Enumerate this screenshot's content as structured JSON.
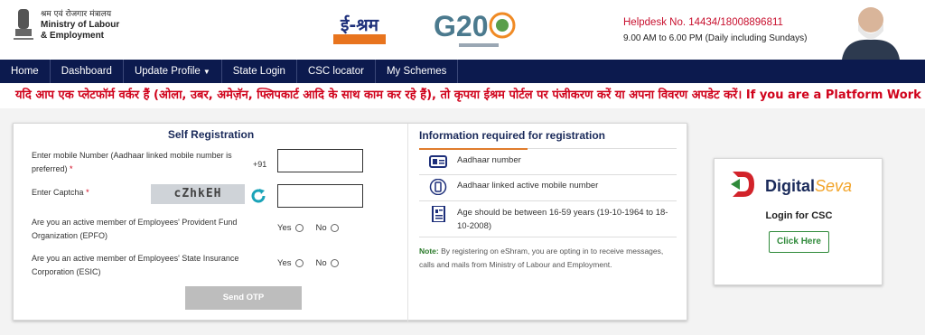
{
  "header": {
    "ministry_hindi": "श्रम एवं रोजगार मंत्रालय",
    "ministry_line1": "Ministry of Labour",
    "ministry_line2": "& Employment",
    "eshram_logo_text": "ई-श्रम",
    "g20_text": "G20",
    "helpdesk": "Helpdesk No. 14434/18008896811",
    "hours": "9.00 AM to 6.00 PM (Daily including Sundays)"
  },
  "nav": {
    "items": [
      "Home",
      "Dashboard",
      "Update Profile",
      "State Login",
      "CSC locator",
      "My Schemes"
    ]
  },
  "ticker": "यदि आप एक प्लेटफॉर्म वर्कर हैं (ओला, उबर, अमेज़ॅन, फ्लिपकार्ट आदि के साथ काम कर रहे हैं), तो कृपया ईश्रम पोर्टल पर पंजीकरण करें या अपना विवरण अपडेट करें। If you are a Platform Work",
  "self_registration": {
    "title": "Self Registration",
    "mobile_label": "Enter mobile Number (Aadhaar linked mobile number is preferred)",
    "country_code": "+91",
    "captcha_label": "Enter Captcha",
    "captcha_text": "cZhkEH",
    "epfo_label": "Are you an active member of Employees' Provident Fund Organization (EPFO)",
    "esic_label": "Are you an active member of Employees' State Insurance Corporation (ESIC)",
    "yes": "Yes",
    "no": "No",
    "send_otp": "Send OTP"
  },
  "info": {
    "title": "Information required for registration",
    "items": [
      "Aadhaar number",
      "Aadhaar linked active mobile number",
      "Age should be between 16-59 years (19-10-1964 to 18-10-2008)"
    ],
    "note_label": "Note:",
    "note_text": " By registering on eShram, you are opting in to receive messages, calls and mails from Ministry of Labour and Employment."
  },
  "csc": {
    "logo_digital": "Digital",
    "logo_seva": "Seva",
    "login_label": "Login for CSC",
    "click_here": "Click Here"
  },
  "colors": {
    "navbar": "#0c1a4e",
    "ticker_text": "#d0021b",
    "helpdesk": "#c8102e",
    "click_here": "#2f8a3a"
  }
}
